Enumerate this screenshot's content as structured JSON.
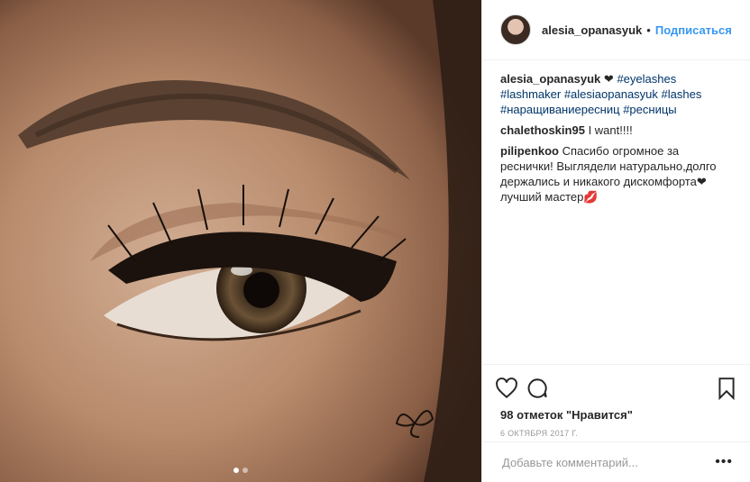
{
  "post": {
    "username": "alesia_opanasyuk",
    "separator": "•",
    "follow_label": "Подписаться"
  },
  "caption": {
    "username": "alesia_opanasyuk",
    "emoji": "❤",
    "tags": [
      "#eyelashes",
      "#lashmaker",
      "#alesiaopanasyuk",
      "#lashes",
      "#наращиваниересниц",
      "#ресницы"
    ]
  },
  "comments": [
    {
      "username": "chalethoskin95",
      "text": "I want!!!!"
    },
    {
      "username": "pilipenkoo",
      "text": "Спасибо огромное за реснички! Выглядели натурально,долго держались и никакого дискомфорта❤лучший мастер💋"
    }
  ],
  "stats": {
    "likes": "98 отметок \"Нравится\"",
    "date": "6 ОКТЯБРЯ 2017 Г."
  },
  "comment_box": {
    "placeholder": "Добавьте комментарий...",
    "more": "•••"
  },
  "icons": {
    "like": "heart-icon",
    "comment": "comment-icon",
    "save": "bookmark-icon"
  },
  "colors": {
    "link": "#3897f0",
    "hashtag": "#003569",
    "text": "#262626",
    "muted": "#999999",
    "border": "#efefef"
  }
}
